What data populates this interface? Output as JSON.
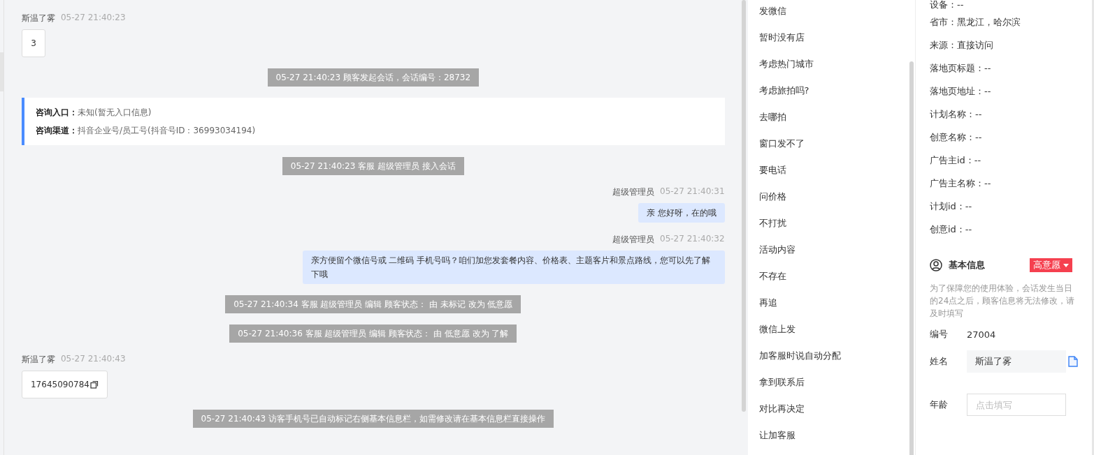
{
  "chat": {
    "messages": [
      {
        "kind": "customer",
        "sender": "斯温了雾",
        "time": "05-27 21:40:23",
        "text": "3",
        "copy": false
      },
      {
        "kind": "system",
        "text": "05-27 21:40:23 顾客发起会话，会话编号：28732"
      },
      {
        "kind": "entry",
        "lines": [
          {
            "label": "咨询入口：",
            "value": "未知(暂无入口信息)"
          },
          {
            "label": "咨询渠道：",
            "value": "抖音企业号/员工号(抖音号ID：36993034194)"
          }
        ]
      },
      {
        "kind": "system",
        "text": "05-27 21:40:23 客服 超级管理员 接入会话"
      },
      {
        "kind": "agent",
        "sender": "超级管理员",
        "time": "05-27 21:40:31",
        "text": "亲 您好呀，在的哦"
      },
      {
        "kind": "agent",
        "sender": "超级管理员",
        "time": "05-27 21:40:32",
        "text": "亲方便留个微信号或 二维码 手机号吗？咱们加您发套餐内容、价格表、主题客片和景点路线，您可以先了解下哦"
      },
      {
        "kind": "system",
        "text": "05-27 21:40:34 客服 超级管理员 编辑 顾客状态： 由 未标记 改为 低意愿"
      },
      {
        "kind": "system",
        "text": "05-27 21:40:36 客服 超级管理员 编辑 顾客状态： 由 低意愿 改为 了解"
      },
      {
        "kind": "customer",
        "sender": "斯温了雾",
        "time": "05-27 21:40:43",
        "text": "17645090784",
        "copy": true
      },
      {
        "kind": "system",
        "text": "05-27 21:40:43 访客手机号已自动标记右侧基本信息栏，如需修改请在基本信息栏直接操作"
      }
    ]
  },
  "quick_replies": [
    "发微信",
    "暂时没有店",
    "考虑热门城市",
    "考虑旅拍吗?",
    "去哪拍",
    "窗口发不了",
    "要电话",
    "问价格",
    "不打扰",
    "活动内容",
    "不存在",
    "再追",
    "微信上发",
    "加客服时说自动分配",
    "拿到联系后",
    "对比再决定",
    "让加客服"
  ],
  "visitor_info": [
    "设备：--",
    "省市：黑龙江，哈尔滨",
    "来源：直接访问",
    "落地页标题：--",
    "落地页地址：--",
    "计划名称：--",
    "创意名称：--",
    "广告主id：--",
    "广告主名称：--",
    "计划id：--",
    "创意id：--"
  ],
  "basic_info": {
    "title": "基本信息",
    "intent_tag": "高意愿",
    "notice": "为了保障您的使用体验，会话发生当日的24点之后，顾客信息将无法修改，请及时填写",
    "fields": [
      {
        "kind": "text",
        "label": "编号",
        "value": "27004"
      },
      {
        "kind": "filled",
        "label": "姓名",
        "value": "斯温了雾"
      },
      {
        "kind": "input",
        "label": "年龄",
        "placeholder": "点击填写"
      }
    ]
  }
}
